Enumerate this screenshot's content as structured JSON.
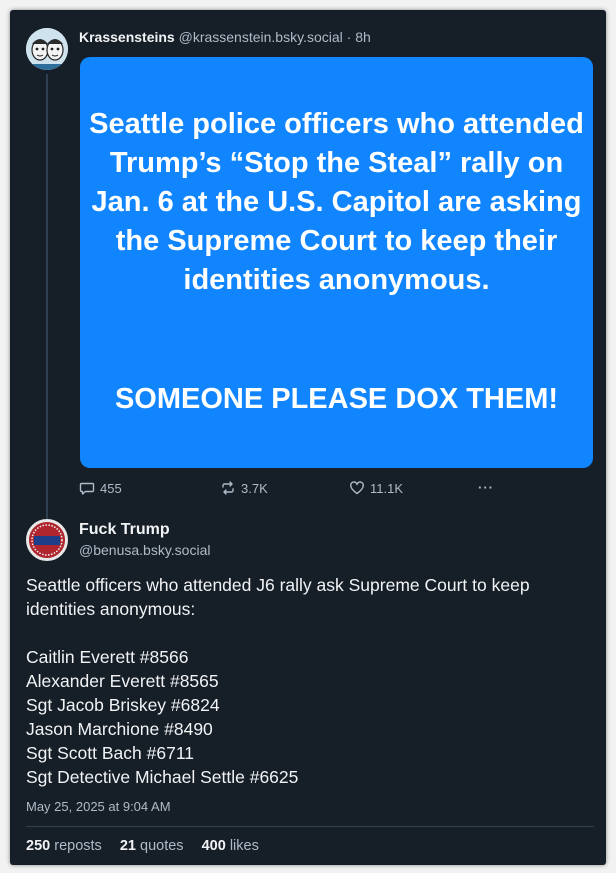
{
  "post1": {
    "author": "Krassensteins",
    "handle": "@krassenstein.bsky.social",
    "separator": "·",
    "time": "8h",
    "image_text": {
      "paragraph1": "Seattle police officers who attended Trump’s “Stop the Steal” rally on Jan. 6 at the U.S. Capitol are asking the Supreme Court to keep their identities anonymous.",
      "paragraph2": "SOMEONE PLEASE DOX THEM!"
    },
    "image_bg": "#1185fe",
    "actions": {
      "replies": "455",
      "reposts": "3.7K",
      "likes": "11.1K",
      "more": "···"
    },
    "icons": {
      "reply": "reply-icon",
      "repost": "repost-icon",
      "like": "heart-icon",
      "more": "more-icon"
    }
  },
  "post2": {
    "author": "Fuck Trump",
    "avatar_text": "FUCK TRUMP",
    "handle": "@benusa.bsky.social",
    "intro": "Seattle officers who attended J6 rally ask Supreme Court to keep identities anonymous:",
    "names": [
      "Caitlin Everett #8566",
      "Alexander Everett #8565",
      "Sgt Jacob Briskey #6824",
      "Jason Marchione #8490",
      "Sgt Scott Bach #6711",
      "Sgt Detective Michael Settle #6625"
    ],
    "timestamp": "May 25, 2025 at 9:04 AM",
    "stats": {
      "reposts_count": "250",
      "reposts_label": "reposts",
      "quotes_count": "21",
      "quotes_label": "quotes",
      "likes_count": "400",
      "likes_label": "likes"
    }
  },
  "colors": {
    "background": "#161e27",
    "text_primary": "#f1f3f5",
    "text_secondary": "#aebbc9",
    "accent": "#1185fe"
  }
}
